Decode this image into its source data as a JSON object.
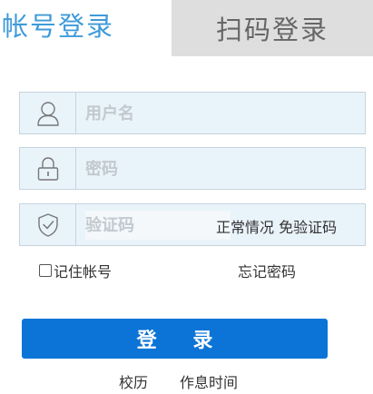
{
  "tabs": {
    "account_login": "帐号登录",
    "qr_login": "扫码登录"
  },
  "fields": {
    "username_placeholder": "用户名",
    "password_placeholder": "密码",
    "captcha_placeholder": "验证码",
    "captcha_hint": "正常情况 免验证码"
  },
  "options": {
    "remember_label": "记住帐号",
    "forgot_label": "忘记密码"
  },
  "login_button": "登  录",
  "footer": {
    "calendar": "校历",
    "schedule": "作息时间"
  },
  "colors": {
    "accent": "#3f9ad9",
    "button": "#0b74d6",
    "field_bg": "#e9f3fa",
    "tab_inactive_bg": "#dedede"
  },
  "icons": {
    "username": "user-icon",
    "password": "lock-icon",
    "captcha": "shield-check-icon"
  }
}
